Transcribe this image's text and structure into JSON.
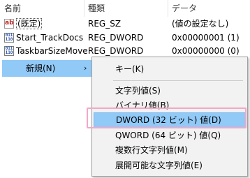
{
  "columns": {
    "name": "名前",
    "type": "種類",
    "data": "データ"
  },
  "values": [
    {
      "icon": "string-value-icon",
      "icon_text": "ab",
      "name": "(既定)",
      "type": "REG_SZ",
      "data": "(値の設定なし)"
    },
    {
      "icon": "binary-value-icon",
      "icon_text_top": "011",
      "icon_text_bottom": "110",
      "name": "Start_TrackDocs",
      "type": "REG_DWORD",
      "data": "0x00000001 (1)"
    },
    {
      "icon": "binary-value-icon",
      "icon_text_top": "011",
      "icon_text_bottom": "110",
      "name": "TaskbarSizeMove",
      "type": "REG_DWORD",
      "data": "0x00000000 (0)"
    }
  ],
  "context_menu": {
    "new_label": "新規(N)",
    "arrow": "›"
  },
  "submenu": {
    "items": [
      {
        "label": "キー(K)"
      },
      {
        "label": "文字列値(S)"
      },
      {
        "label": "バイナリ値(B)"
      },
      {
        "label": "DWORD (32 ビット) 値(D)"
      },
      {
        "label": "QWORD (64 ビット) 値(Q)"
      },
      {
        "label": "複数行文字列値(M)"
      },
      {
        "label": "展開可能な文字列値(E)"
      }
    ]
  },
  "colors": {
    "highlight": "#91c9f7",
    "annotation_outline": "#f4a7c6"
  }
}
